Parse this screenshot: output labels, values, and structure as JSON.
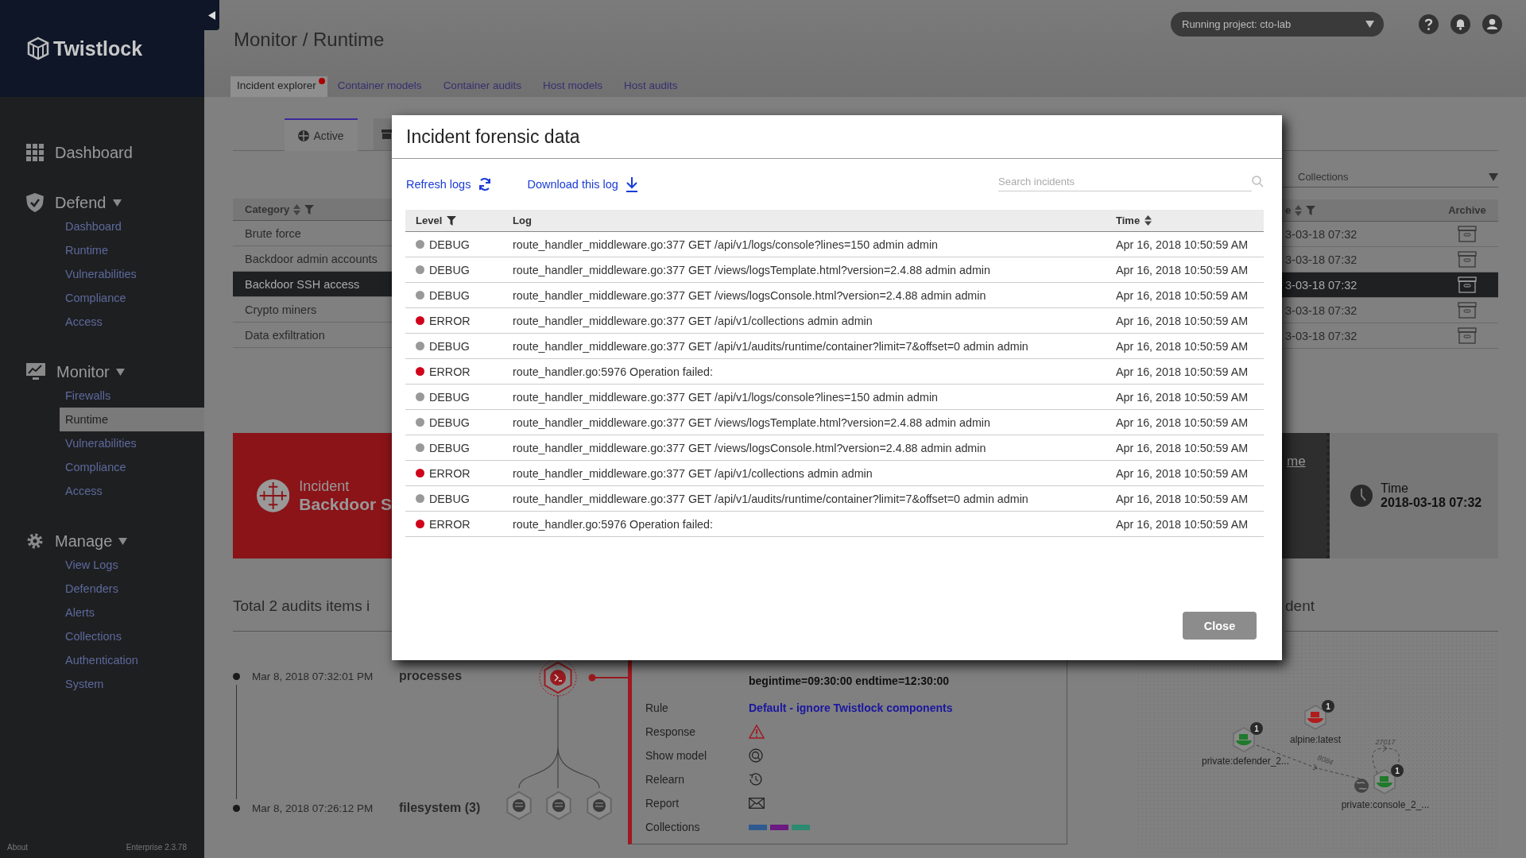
{
  "sidebar": {
    "logo": "Twistlock",
    "home": {
      "label": "Dashboard"
    },
    "sections": [
      {
        "label": "Defend",
        "expanded": true,
        "items": [
          {
            "label": "Dashboard",
            "selected": false
          },
          {
            "label": "Runtime",
            "selected": false
          },
          {
            "label": "Vulnerabilities",
            "selected": false
          },
          {
            "label": "Compliance",
            "selected": false
          },
          {
            "label": "Access",
            "selected": false
          }
        ]
      },
      {
        "label": "Monitor",
        "expanded": true,
        "items": [
          {
            "label": "Firewalls",
            "selected": false
          },
          {
            "label": "Runtime",
            "selected": true
          },
          {
            "label": "Vulnerabilities",
            "selected": false
          },
          {
            "label": "Compliance",
            "selected": false
          },
          {
            "label": "Access",
            "selected": false
          }
        ]
      },
      {
        "label": "Manage",
        "expanded": true,
        "items": [
          {
            "label": "View Logs",
            "selected": false
          },
          {
            "label": "Defenders",
            "selected": false
          },
          {
            "label": "Alerts",
            "selected": false
          },
          {
            "label": "Collections",
            "selected": false
          },
          {
            "label": "Authentication",
            "selected": false
          },
          {
            "label": "System",
            "selected": false
          }
        ]
      }
    ],
    "footer": {
      "about": "About",
      "version": "Enterprise 2.3.78"
    }
  },
  "header": {
    "title": "Monitor / Runtime",
    "project": "Running project: cto-lab",
    "tabs": [
      {
        "label": "Incident explorer",
        "selected": true,
        "alert": true
      },
      {
        "label": "Container models",
        "selected": false,
        "alert": false
      },
      {
        "label": "Container audits",
        "selected": false,
        "alert": false
      },
      {
        "label": "Host models",
        "selected": false,
        "alert": false
      },
      {
        "label": "Host audits",
        "selected": false,
        "alert": false
      }
    ]
  },
  "subtabs": [
    {
      "label": "Active",
      "selected": true
    },
    {
      "selected": false
    }
  ],
  "categories": {
    "header": "Category",
    "rows": [
      {
        "label": "Brute force",
        "selected": false
      },
      {
        "label": "Backdoor admin accounts",
        "selected": false
      },
      {
        "label": "Backdoor SSH access",
        "selected": true
      },
      {
        "label": "Crypto miners",
        "selected": false
      },
      {
        "label": "Data exfiltration",
        "selected": false
      }
    ]
  },
  "incidents_right": {
    "placeholder": "Collections",
    "column_1": "e",
    "archive": "Archive",
    "rows": [
      {
        "time": "3-03-18 07:32",
        "selected": false
      },
      {
        "time": "3-03-18 07:32",
        "selected": false
      },
      {
        "time": "3-03-18 07:32",
        "selected": true
      },
      {
        "time": "3-03-18 07:32",
        "selected": false
      },
      {
        "time": "3-03-18 07:32",
        "selected": false
      }
    ]
  },
  "banner": {
    "label": "Incident",
    "name": "Backdoor S",
    "link": "me",
    "time_label": "Time",
    "time": "2018-03-18 07:32"
  },
  "audits": {
    "title": "Total 2 audits items i",
    "right_title": "dent",
    "events": [
      {
        "time": "Mar 8, 2018 07:32:01 PM",
        "name": "processes"
      },
      {
        "time": "Mar 8, 2018 07:26:12 PM",
        "name": "filesystem (3)"
      }
    ]
  },
  "details": {
    "description": "begintime=09:30:00 endtime=12:30:00",
    "rows": [
      {
        "kind": "link",
        "label": "Rule",
        "value": "Default - ignore Twistlock components"
      },
      {
        "kind": "icon",
        "label": "Response"
      },
      {
        "kind": "icon",
        "label": "Show model"
      },
      {
        "kind": "icon",
        "label": "Relearn"
      },
      {
        "kind": "icon",
        "label": "Report"
      },
      {
        "kind": "colors",
        "label": "Collections",
        "collections": [
          {
            "color": "#2f5a8f"
          },
          {
            "color": "#6a1a80"
          },
          {
            "color": "#2b8a70"
          }
        ]
      }
    ]
  },
  "network": {
    "nodes": [
      {
        "label": "private:defender_2...",
        "count": "1",
        "color": "#1f7a2c"
      },
      {
        "label": "alpine:latest",
        "count": "1",
        "color": "#b01c1c"
      },
      {
        "label": "private:console_2_...",
        "count": "1",
        "color": "#1f7a2c"
      }
    ],
    "edges": [
      {
        "label": "8084"
      },
      {
        "label": "27017"
      }
    ]
  },
  "modal": {
    "title": "Incident forensic data",
    "refresh": "Refresh logs",
    "download": "Download this log",
    "search_placeholder": "Search incidents",
    "columns": {
      "level": "Level",
      "log": "Log",
      "time": "Time"
    },
    "close": "Close",
    "rows": [
      {
        "level": "DEBUG",
        "color": "#999999",
        "log": "route_handler_middleware.go:377 GET /api/v1/logs/console?lines=150 admin admin",
        "time": "Apr 16, 2018 10:50:59 AM"
      },
      {
        "level": "DEBUG",
        "color": "#999999",
        "log": "route_handler_middleware.go:377 GET /views/logsTemplate.html?version=2.4.88 admin admin",
        "time": "Apr 16, 2018 10:50:59 AM"
      },
      {
        "level": "DEBUG",
        "color": "#999999",
        "log": "route_handler_middleware.go:377 GET /views/logsConsole.html?version=2.4.88 admin admin",
        "time": "Apr 16, 2018 10:50:59 AM"
      },
      {
        "level": "ERROR",
        "color": "#d0021b",
        "log": "route_handler_middleware.go:377 GET /api/v1/collections admin admin",
        "time": "Apr 16, 2018 10:50:59 AM"
      },
      {
        "level": "DEBUG",
        "color": "#999999",
        "log": "route_handler_middleware.go:377 GET /api/v1/audits/runtime/container?limit=7&offset=0 admin admin",
        "time": "Apr 16, 2018 10:50:59 AM"
      },
      {
        "level": "ERROR",
        "color": "#d0021b",
        "log": "route_handler.go:5976 Operation failed:",
        "time": "Apr 16, 2018 10:50:59 AM"
      },
      {
        "level": "DEBUG",
        "color": "#999999",
        "log": "route_handler_middleware.go:377 GET /api/v1/logs/console?lines=150 admin admin",
        "time": "Apr 16, 2018 10:50:59 AM"
      },
      {
        "level": "DEBUG",
        "color": "#999999",
        "log": "route_handler_middleware.go:377 GET /views/logsTemplate.html?version=2.4.88 admin admin",
        "time": "Apr 16, 2018 10:50:59 AM"
      },
      {
        "level": "DEBUG",
        "color": "#999999",
        "log": "route_handler_middleware.go:377 GET /views/logsConsole.html?version=2.4.88 admin admin",
        "time": "Apr 16, 2018 10:50:59 AM"
      },
      {
        "level": "ERROR",
        "color": "#d0021b",
        "log": "route_handler_middleware.go:377 GET /api/v1/collections admin admin",
        "time": "Apr 16, 2018 10:50:59 AM"
      },
      {
        "level": "DEBUG",
        "color": "#999999",
        "log": "route_handler_middleware.go:377 GET /api/v1/audits/runtime/container?limit=7&offset=0 admin admin",
        "time": "Apr 16, 2018 10:50:59 AM"
      },
      {
        "level": "ERROR",
        "color": "#d0021b",
        "log": "route_handler.go:5976 Operation failed:",
        "time": "Apr 16, 2018 10:50:59 AM"
      }
    ]
  }
}
